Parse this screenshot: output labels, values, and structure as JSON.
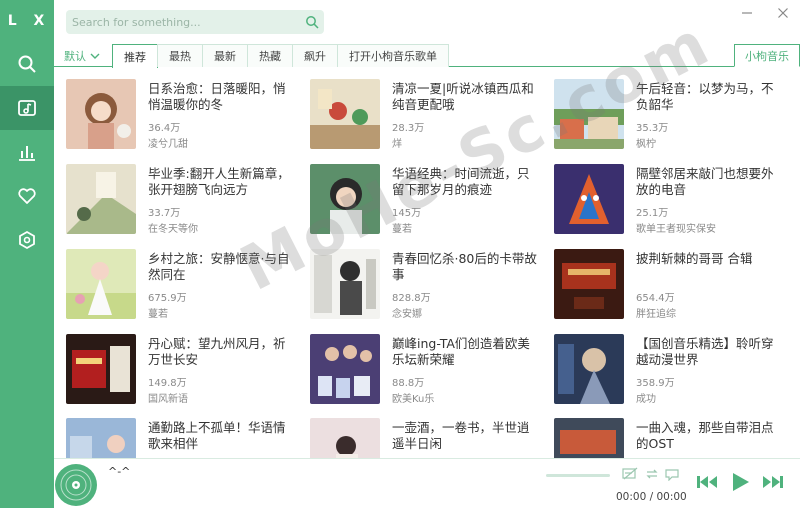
{
  "app": {
    "logo": "L X"
  },
  "search": {
    "placeholder": "Search for something..."
  },
  "sort": {
    "label": "默认"
  },
  "tabs": [
    "推荐",
    "最热",
    "最新",
    "热藏",
    "飙升",
    "打开小枸音乐歌单"
  ],
  "source_tab": "小枸音乐",
  "playlists": [
    {
      "title": "日系治愈：日落暖阳，悄悄温暖你的冬",
      "count": "36.4万",
      "author": "凌兮几甜"
    },
    {
      "title": "清凉一夏|听说冰镇西瓜和纯音更配哦",
      "count": "28.3万",
      "author": "烊"
    },
    {
      "title": "午后轻音：以梦为马，不负韶华",
      "count": "35.3万",
      "author": "枫柠"
    },
    {
      "title": "毕业季:翻开人生新篇章，张开翅膀飞向远方",
      "count": "33.7万",
      "author": "在冬天等你"
    },
    {
      "title": "华语经典：时间流逝，只留下那岁月的痕迹",
      "count": "145万",
      "author": "蔓若"
    },
    {
      "title": "隔壁邻居来敲门也想要外放的电音",
      "count": "25.1万",
      "author": "歌单王者现实保安"
    },
    {
      "title": "乡村之旅：安静惬意·与自然同在",
      "count": "675.9万",
      "author": "蔓若"
    },
    {
      "title": "青春回忆杀·80后的卡带故事",
      "count": "828.8万",
      "author": "念安娜"
    },
    {
      "title": "披荆斩棘的哥哥 合辑",
      "count": "654.4万",
      "author": "胖狂追综"
    },
    {
      "title": "丹心赋：望九州风月，祈万世长安",
      "count": "149.8万",
      "author": "国风新语"
    },
    {
      "title": "巅峰ing-TA们创造着欧美乐坛新荣耀",
      "count": "88.8万",
      "author": "欧美Ku乐"
    },
    {
      "title": "【国创音乐精选】聆听穿越动漫世界",
      "count": "358.9万",
      "author": "成功"
    },
    {
      "title": "通勤路上不孤单！华语情歌来相伴",
      "count": "",
      "author": ""
    },
    {
      "title": "一壶酒，一卷书，半世逍遥半日闲",
      "count": "",
      "author": ""
    },
    {
      "title": "一曲入魂，那些自带泪点的OST",
      "count": "",
      "author": ""
    }
  ],
  "player": {
    "song": "^-^",
    "time": "00:00 / 00:00",
    "progress": 0
  },
  "watermark": "MoHe-Sc.com",
  "colors": {
    "accent": "#4fb27d",
    "accent_dark": "#3b9467"
  },
  "icons": [
    "search-icon",
    "music-library-icon",
    "chart-icon",
    "heart-icon",
    "settings-icon",
    "minimize-icon",
    "close-icon",
    "prev-icon",
    "play-icon",
    "next-icon"
  ]
}
